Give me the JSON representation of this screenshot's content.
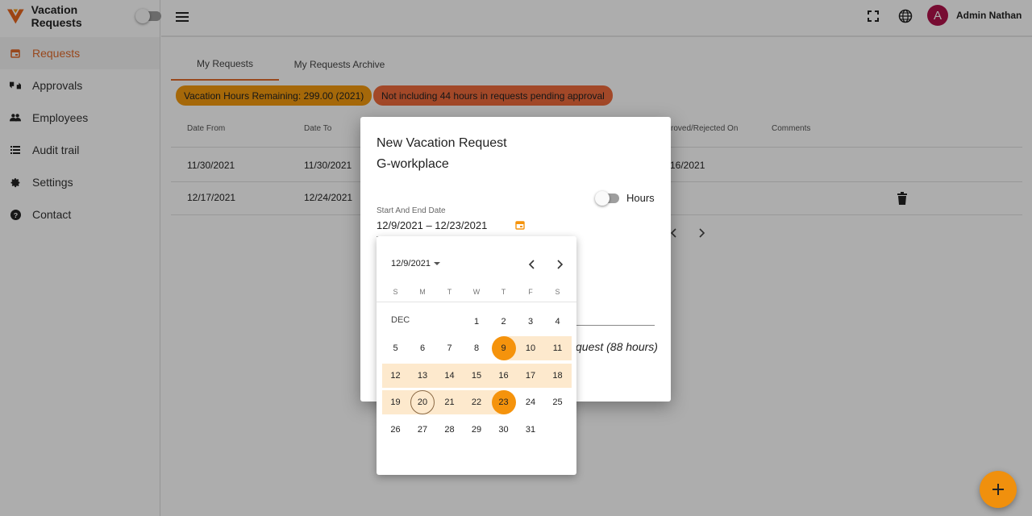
{
  "app": {
    "title": "Vacation Requests"
  },
  "sidebar": {
    "items": [
      {
        "label": "Requests",
        "icon": "calendar-icon"
      },
      {
        "label": "Approvals",
        "icon": "thumbs-icon"
      },
      {
        "label": "Employees",
        "icon": "people-icon"
      },
      {
        "label": "Audit trail",
        "icon": "list-icon"
      },
      {
        "label": "Settings",
        "icon": "gear-icon"
      },
      {
        "label": "Contact",
        "icon": "help-icon"
      }
    ]
  },
  "topbar": {
    "avatar_letter": "A",
    "user_name": "Admin Nathan"
  },
  "tabs": [
    {
      "label": "My Requests"
    },
    {
      "label": "My Requests Archive"
    }
  ],
  "chips": {
    "remaining": "Vacation Hours Remaining: 299.00 (2021)",
    "pending": "Not including 44 hours in requests pending approval"
  },
  "table": {
    "headers": {
      "date_from": "Date From",
      "date_to": "Date To",
      "approved_on": "roved/Rejected On",
      "comments": "Comments"
    },
    "rows": [
      {
        "date_from": "11/30/2021",
        "date_to": "11/30/2021",
        "approved_on": "16/2021"
      },
      {
        "date_from": "12/17/2021",
        "date_to": "12/24/2021",
        "approved_on": ""
      }
    ]
  },
  "dialog": {
    "title": "New Vacation Request",
    "subtitle": "G-workplace",
    "hours_label": "Hours",
    "field_label": "Start And End Date",
    "field_value": "12/9/2021 – 12/23/2021",
    "partial_text": "quest (88 hours)"
  },
  "calendar": {
    "period_label": "12/9/2021",
    "weekdays": [
      "S",
      "M",
      "T",
      "W",
      "T",
      "F",
      "S"
    ],
    "month_label": "DEC",
    "days": [
      "1",
      "2",
      "3",
      "4",
      "5",
      "6",
      "7",
      "8",
      "9",
      "10",
      "11",
      "12",
      "13",
      "14",
      "15",
      "16",
      "17",
      "18",
      "19",
      "20",
      "21",
      "22",
      "23",
      "24",
      "25",
      "26",
      "27",
      "28",
      "29",
      "30",
      "31"
    ],
    "range_start": 9,
    "range_end": 23,
    "today": 20
  },
  "colors": {
    "accent": "#e06a2c",
    "selected": "#f5930c",
    "range": "#fde9cd",
    "chip_orange": "#f39a0e",
    "chip_red": "#ef6a3c",
    "avatar": "#b0124a"
  }
}
